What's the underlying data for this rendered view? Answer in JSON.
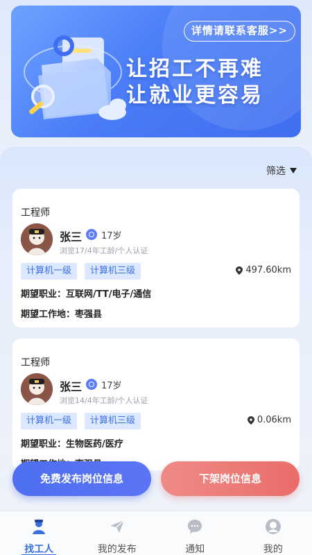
{
  "banner": {
    "contact_label": "详情请联系客服>>",
    "headline_1": "让招工不再难",
    "headline_2": "让就业更容易"
  },
  "filter": {
    "label": "筛选"
  },
  "cards": [
    {
      "job": "工程师",
      "name": "张三",
      "age": "17岁",
      "meta": "浏览17/4年工龄/个人认证",
      "tags": [
        "计算机一级",
        "计算机三级"
      ],
      "distance": "497.60km",
      "desired_job": "期望职业：互联网/TT/电子/通信",
      "desired_location": "期望工作地：枣强县"
    },
    {
      "job": "工程师",
      "name": "张三",
      "age": "17岁",
      "meta": "浏览14/4年工龄/个人认证",
      "tags": [
        "计算机一级",
        "计算机三级"
      ],
      "distance": "0.06km",
      "desired_job": "期望职业：生物医药/医疗",
      "desired_location": "期望工作地：枣强县"
    }
  ],
  "actions": {
    "publish": "免费发布岗位信息",
    "offshelf": "下架岗位信息"
  },
  "tabbar": {
    "tabs": [
      {
        "label": "找工人",
        "icon": "worker-icon",
        "active": true
      },
      {
        "label": "我的发布",
        "icon": "send-icon",
        "active": false
      },
      {
        "label": "通知",
        "icon": "message-icon",
        "active": false
      },
      {
        "label": "我的",
        "icon": "profile-icon",
        "active": false
      }
    ]
  },
  "colors": {
    "primary": "#3a6fe0",
    "danger": "#e96d6a",
    "tag_bg": "#dbe8ff"
  }
}
